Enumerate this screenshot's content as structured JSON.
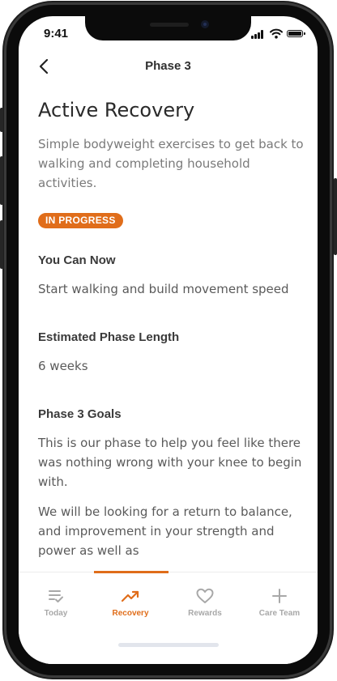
{
  "status_bar": {
    "time": "9:41"
  },
  "nav": {
    "title": "Phase 3"
  },
  "phase": {
    "title": "Active Recovery",
    "description": "Simple bodyweight exercises to get back to walking and completing household activities.",
    "status_badge": "IN PROGRESS",
    "status_color": "#e06d1a"
  },
  "sections": {
    "can_now": {
      "title": "You Can Now",
      "text": "Start walking and build movement speed"
    },
    "phase_length": {
      "title": "Estimated Phase Length",
      "text": "6 weeks"
    },
    "goals": {
      "title": "Phase 3 Goals",
      "paragraph1": "This is our phase to help you feel like there was nothing wrong with your knee to begin with.",
      "paragraph2": "We will be looking for a return to balance, and improvement in your strength and power as well as"
    }
  },
  "tabbar": {
    "active": "Recovery",
    "accent": "#e06d1a",
    "items": [
      {
        "label": "Today",
        "icon": "checklist-icon"
      },
      {
        "label": "Recovery",
        "icon": "trending-up-icon"
      },
      {
        "label": "Rewards",
        "icon": "heart-icon"
      },
      {
        "label": "Care Team",
        "icon": "plus-icon"
      }
    ]
  }
}
